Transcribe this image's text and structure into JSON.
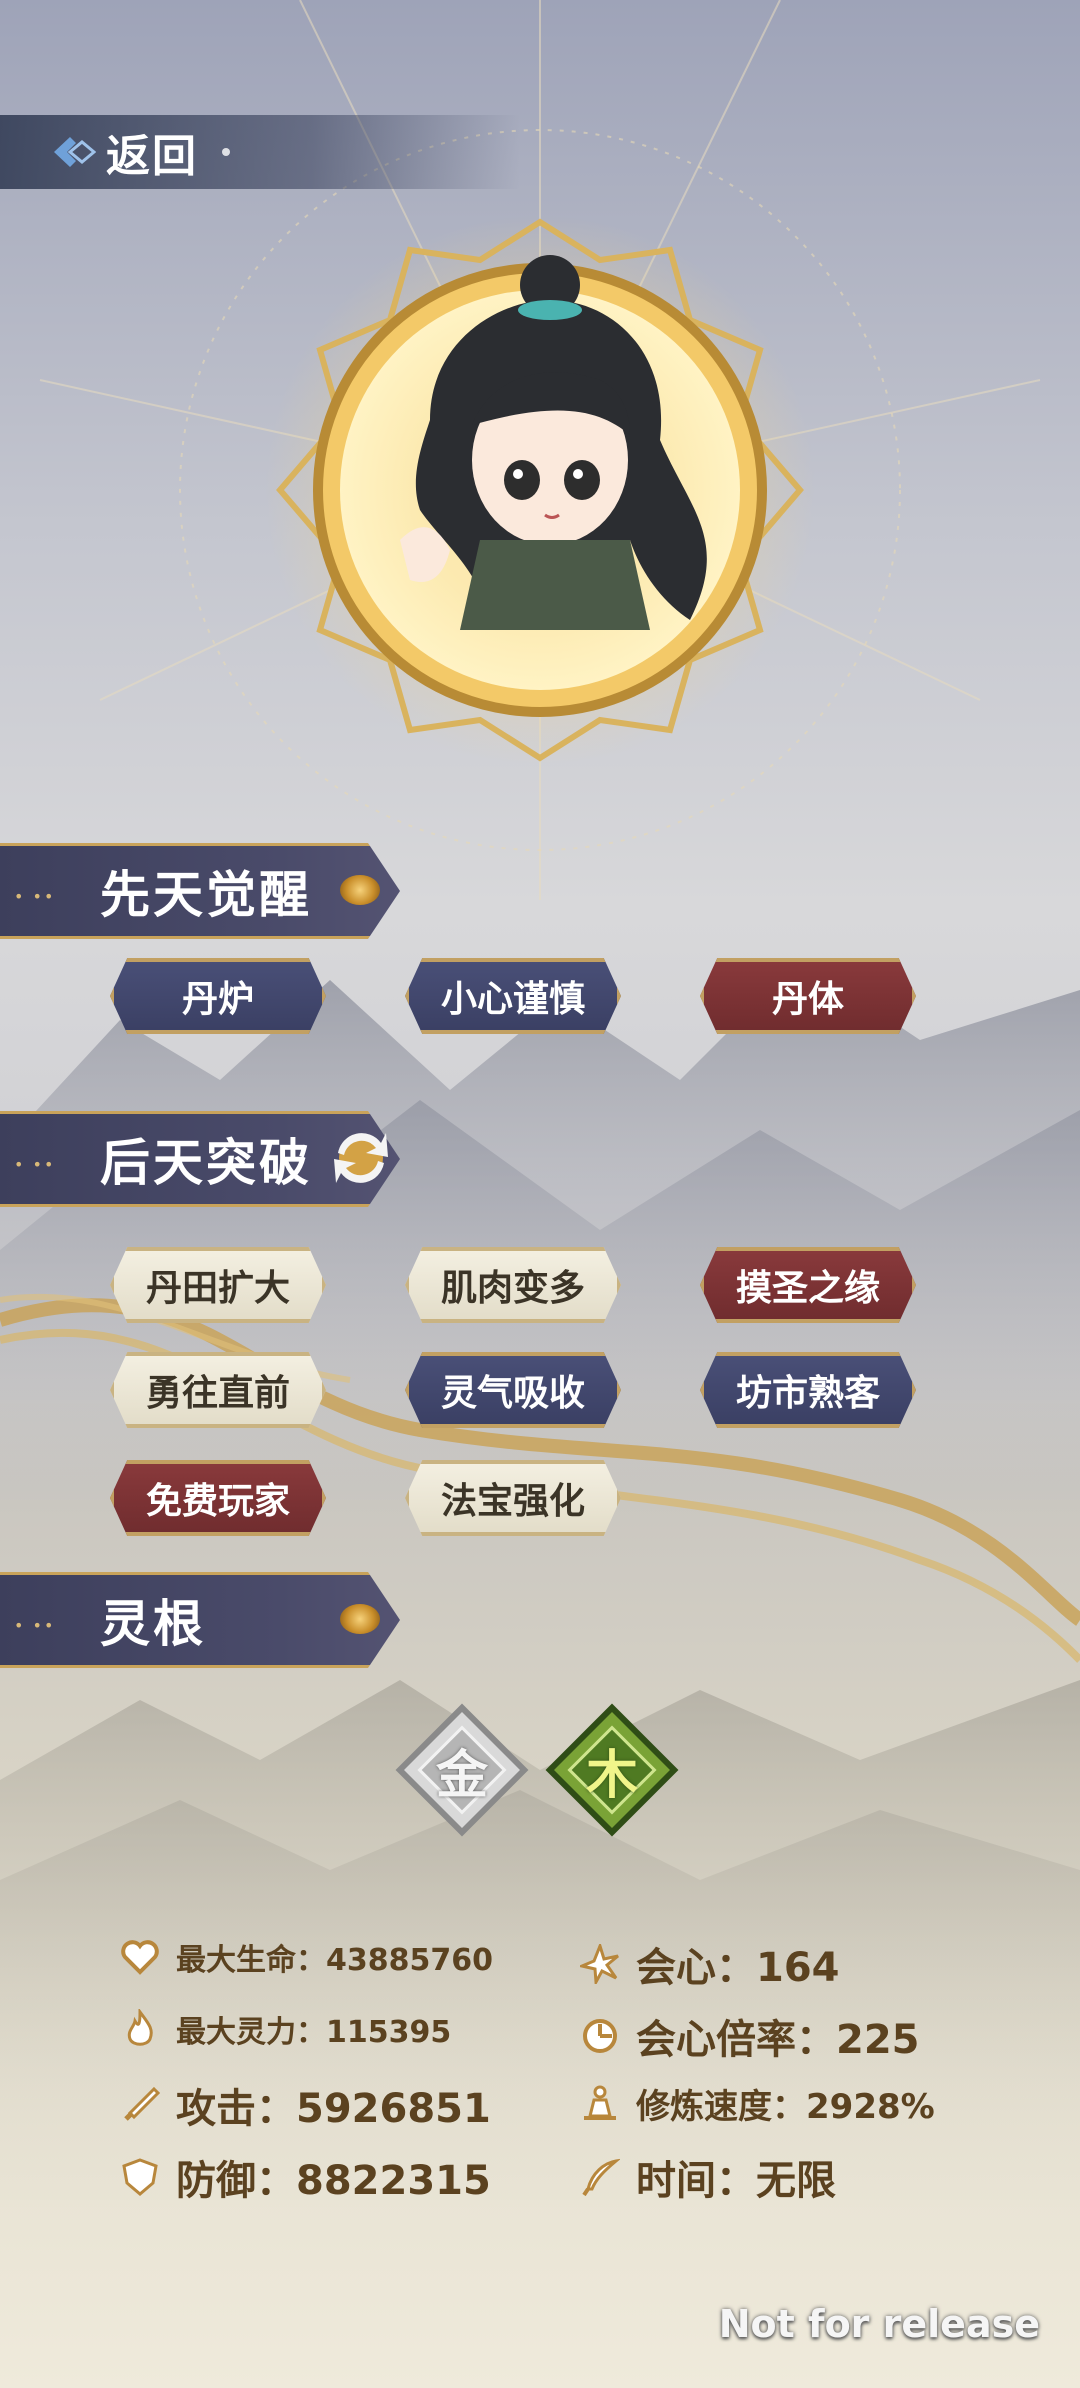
{
  "header": {
    "back_label": "返回"
  },
  "sections": {
    "innate": {
      "title": "先天觉醒"
    },
    "acquired": {
      "title": "后天突破"
    },
    "spirit_root": {
      "title": "灵根"
    }
  },
  "innate_tags": [
    {
      "label": "丹炉",
      "style": "blue"
    },
    {
      "label": "小心谨慎",
      "style": "blue"
    },
    {
      "label": "丹体",
      "style": "red"
    }
  ],
  "acquired_tags": [
    {
      "label": "丹田扩大",
      "style": "white"
    },
    {
      "label": "肌肉变多",
      "style": "white"
    },
    {
      "label": "摸圣之缘",
      "style": "red"
    },
    {
      "label": "勇往直前",
      "style": "white"
    },
    {
      "label": "灵气吸收",
      "style": "blue"
    },
    {
      "label": "坊市熟客",
      "style": "blue"
    },
    {
      "label": "免费玩家",
      "style": "red"
    },
    {
      "label": "法宝强化",
      "style": "white"
    }
  ],
  "spirit_roots": [
    {
      "label": "金",
      "color": "#9c9c9c"
    },
    {
      "label": "木",
      "color": "#5f8a2a"
    }
  ],
  "stats": {
    "max_hp": "最大生命：43885760",
    "max_mana": "最大灵力：115395",
    "attack": "攻击：5926851",
    "defense": "防御：8822315",
    "crit": "会心：164",
    "crit_rate": "会心倍率：225",
    "cultivation_speed": "修炼速度：2928%",
    "time": "时间：无限"
  },
  "icons": {
    "max_hp": "heart-icon",
    "max_mana": "flame-icon",
    "attack": "sword-icon",
    "defense": "shield-icon",
    "crit": "burst-icon",
    "crit_rate": "target-icon",
    "cultivation_speed": "meditation-icon",
    "time": "feather-icon"
  },
  "watermark": "Not for release",
  "colors": {
    "gold": "#c9a35a",
    "navy": "#3d3f5c",
    "stat_text": "#5b4220"
  }
}
